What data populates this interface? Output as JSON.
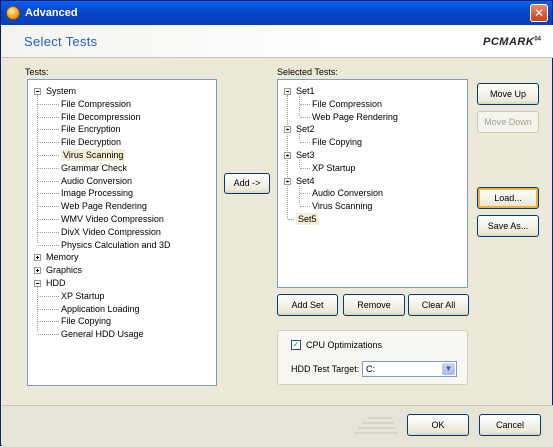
{
  "window": {
    "title": "Advanced",
    "close_glyph": "✕"
  },
  "header": {
    "title": "Select Tests",
    "logo_main": "PCMARK",
    "logo_sup": "04"
  },
  "tests": {
    "label": "Tests:",
    "groups": {
      "system": {
        "label": "System",
        "expander": "minus"
      },
      "memory": {
        "label": "Memory",
        "expander": "plus"
      },
      "graphics": {
        "label": "Graphics",
        "expander": "plus"
      },
      "hdd": {
        "label": "HDD",
        "expander": "minus"
      }
    },
    "system_items": [
      "File Compression",
      "File Decompression",
      "File Encryption",
      "File Decryption",
      "Virus Scanning",
      "Grammar Check",
      "Audio Conversion",
      "Image Processing",
      "Web Page Rendering",
      "WMV Video Compression",
      "DivX Video Compression",
      "Physics Calculation and 3D"
    ],
    "selected_item": "Virus Scanning",
    "hdd_items": [
      "XP Startup",
      "Application Loading",
      "File Copying",
      "General HDD Usage"
    ]
  },
  "selected_tests": {
    "label": "Selected Tests:",
    "sets": [
      {
        "label": "Set1",
        "items": [
          "File Compression",
          "Web Page Rendering"
        ]
      },
      {
        "label": "Set2",
        "items": [
          "File Copying"
        ]
      },
      {
        "label": "Set3",
        "items": [
          "XP Startup"
        ]
      },
      {
        "label": "Set4",
        "items": [
          "Audio Conversion",
          "Virus Scanning"
        ]
      },
      {
        "label": "Set5",
        "items": []
      }
    ],
    "highlighted_set": "Set5"
  },
  "buttons": {
    "add": "Add ->",
    "move_up": "Move Up",
    "move_down": "Move Down",
    "load": "Load...",
    "save_as": "Save As...",
    "add_set": "Add Set",
    "remove": "Remove",
    "clear_all": "Clear All",
    "ok": "OK",
    "cancel": "Cancel"
  },
  "options": {
    "cpu_optimizations_label": "CPU Optimizations",
    "cpu_optimizations_checked": true,
    "check_glyph": "✓",
    "hdd_target_label": "HDD Test Target:",
    "hdd_target_value": "C:",
    "dropdown_glyph": "▼"
  }
}
